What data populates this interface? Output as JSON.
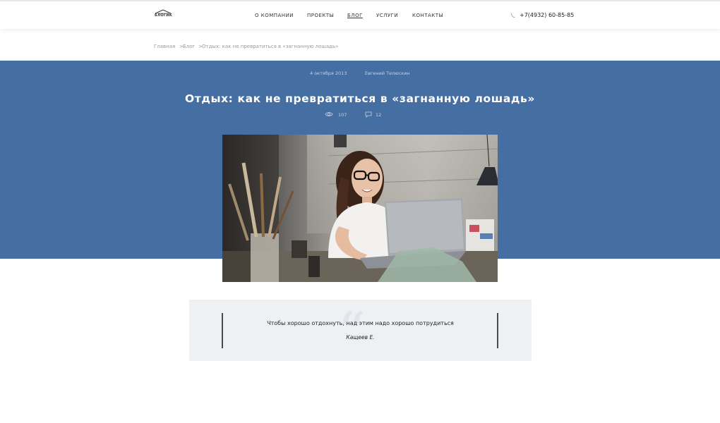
{
  "header": {
    "logo_text": "БЛОГИК",
    "nav": [
      {
        "label": "О компании"
      },
      {
        "label": "Проекты"
      },
      {
        "label": "Блог"
      },
      {
        "label": "Услуги"
      },
      {
        "label": "Контакты"
      }
    ],
    "active_nav": "Блог",
    "phone": "+7(4932) 60-85-85",
    "phone_icon": "phone-icon",
    "logo_icon": "roof-icon"
  },
  "breadcrumb": [
    {
      "label": "Главная"
    },
    {
      "label": "Блог"
    },
    {
      "label": "Отдых: как не превратиться в «загнанную лошадь»"
    }
  ],
  "article": {
    "date": "4 октября 2013",
    "author": "Евгений Телюскин",
    "title": "Отдых: как не превратиться в «загнанную лошадь»",
    "views": "107",
    "comments": "12",
    "views_icon": "eye-icon",
    "comments_icon": "comment-icon",
    "image": "woman-with-laptop-photo"
  },
  "quote": {
    "text": "Чтобы хорошо отдохнуть, над этим надо хорошо потрудиться",
    "author": "Кащеев Е.",
    "icon": "quote-mark-icon"
  },
  "colors": {
    "hero_background": "#456ea3",
    "quote_background": "#eef0f3"
  }
}
